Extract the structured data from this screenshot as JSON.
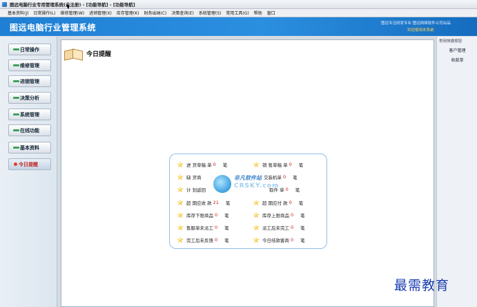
{
  "window": {
    "title": "图远电脑行业专用管理系统(未注册) - [功能导航] - [功能导航]"
  },
  "menu": {
    "items": [
      "基本资料(J)",
      "日常操作(L)",
      "维修管理(W)",
      "进销管理(X)",
      "库存管理(K)",
      "财务出纳(C)",
      "决策查询(E)",
      "系统管理(S)",
      "常用工具(G)",
      "帮助",
      "窗口"
    ]
  },
  "header": {
    "app_name": "图远电脑行业管理系统",
    "slogan": "图远专注研发专业      图远网络软件公司出品",
    "slogan2": "欢迎使用本系统"
  },
  "sidebar": {
    "items": [
      {
        "label": "日常操作"
      },
      {
        "label": "维修管理"
      },
      {
        "label": "进销管理"
      },
      {
        "label": "决策分析"
      },
      {
        "label": "系统管理"
      },
      {
        "label": "在线功能"
      },
      {
        "label": "基本资料"
      },
      {
        "label": "今日提醒",
        "active": true
      }
    ]
  },
  "main": {
    "heading": "今日提醒"
  },
  "reminders": {
    "left": [
      {
        "label": "进 货草稿 单",
        "value": "0",
        "unit": "笔"
      },
      {
        "label": "缺    货商",
        "value": "",
        "unit": ""
      },
      {
        "label": "计 划返回",
        "value": "",
        "unit": ""
      },
      {
        "label": "超 期应收 款",
        "value": "21",
        "unit": "笔"
      },
      {
        "label": "库存下限商品",
        "value": "0",
        "unit": "笔"
      },
      {
        "label": "售服单未派工",
        "value": "0",
        "unit": "笔"
      },
      {
        "label": "完工后未反馈",
        "value": "0",
        "unit": "笔"
      }
    ],
    "right": [
      {
        "label": "销 售草稿 单",
        "value": "0",
        "unit": "笔"
      },
      {
        "label": "交装机单",
        "value": "0",
        "unit": "笔"
      },
      {
        "label": "取件 单",
        "value": "0",
        "unit": "笔"
      },
      {
        "label": "超 期应付 款",
        "value": "0",
        "unit": "笔"
      },
      {
        "label": "库存上限商品",
        "value": "0",
        "unit": "笔"
      },
      {
        "label": "派工后未完工",
        "value": "0",
        "unit": "笔"
      },
      {
        "label": "今日结款客商",
        "value": "0",
        "unit": "笔"
      }
    ]
  },
  "watermark": {
    "top": "非凡软件站",
    "bottom": "CRSKY.com"
  },
  "rightpane": {
    "title": "常用快捷按钮",
    "links": [
      "客户管理",
      "收款单"
    ]
  },
  "brand": {
    "text": "最需教育"
  },
  "colors": {
    "banner": "#2b8fe0",
    "value_red": "#d01818",
    "nav_dash": "#3aa35a"
  }
}
